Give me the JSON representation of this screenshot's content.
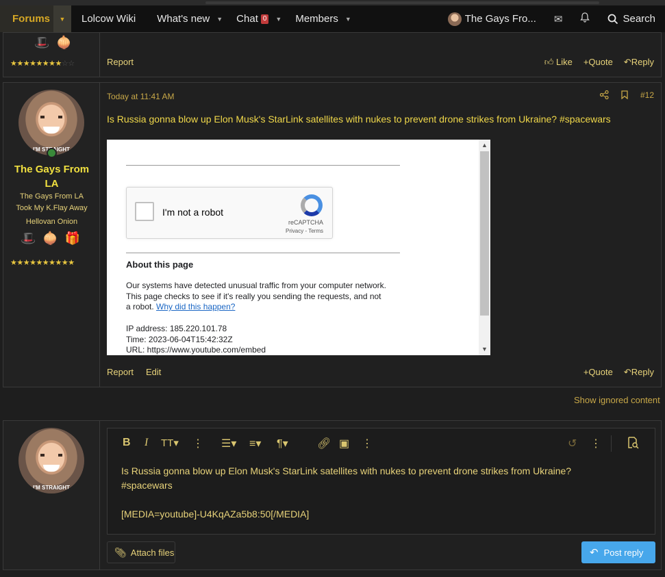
{
  "nav": {
    "forums": "Forums",
    "wiki": "Lolcow Wiki",
    "whats_new": "What's new",
    "chat": "Chat",
    "chat_count": "0",
    "members": "Members",
    "user": "The Gays Fro...",
    "search": "Search"
  },
  "post_prev": {
    "report": "Report",
    "like": "Like",
    "quote": "Quote",
    "reply": "Reply",
    "stars_on": "★★★★★★★★",
    "stars_off": "☆☆"
  },
  "post": {
    "time": "Today at 11:41 AM",
    "number": "#12",
    "user_caption": "I'M STRAIGHT",
    "username": "The Gays From LA",
    "title_line1": "The Gays From LA",
    "title_line2": "Took My K.Flay Away",
    "title_line3": "Hellovan Onion",
    "stars": "★★★★★★★★★★",
    "text": "Is Russia gonna blow up Elon Musk's StarLink satellites with nukes to prevent drone strikes from Ukraine? #spacewars",
    "embed": {
      "captcha_label": "I'm not a robot",
      "captcha_brand": "reCAPTCHA",
      "captcha_terms": "Privacy - Terms",
      "about_title": "About this page",
      "about_text": "Our systems have detected unusual traffic from your computer network. This page checks to see if it's really you sending the requests, and not a robot.",
      "about_link": "Why did this happen?",
      "ip": "IP address: 185.220.101.78",
      "time": "Time: 2023-06-04T15:42:32Z",
      "url": "URL: https://www.youtube.com/embed"
    },
    "report": "Report",
    "edit": "Edit",
    "quote": "Quote",
    "reply": "Reply"
  },
  "ignored": "Show ignored content",
  "editor": {
    "avatar_caption": "I'M STRAIGHT",
    "line1": "Is Russia gonna blow up Elon Musk's StarLink satellites with nukes to prevent drone strikes from Ukraine?",
    "line2": "#spacewars",
    "line3": "[MEDIA=youtube]-U4KqAZa5b8:50[/MEDIA]",
    "attach": "Attach files",
    "post_reply": "Post reply"
  }
}
